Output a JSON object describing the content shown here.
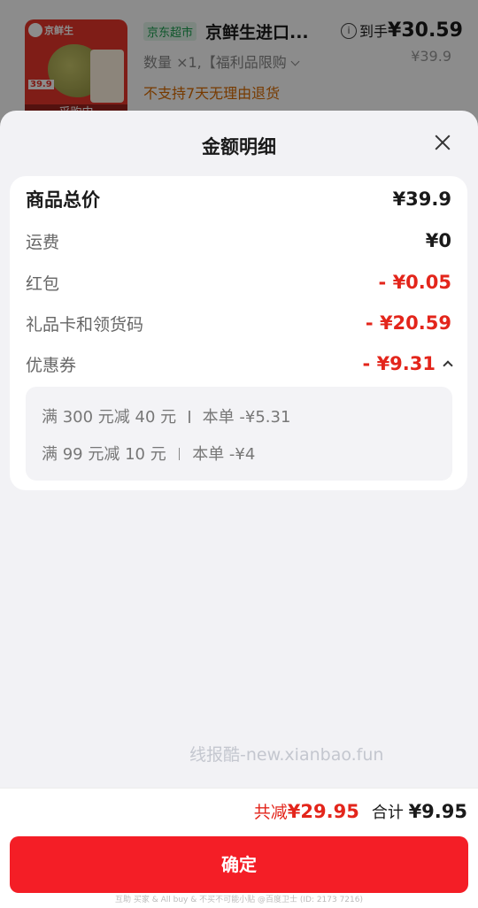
{
  "background_order": {
    "thumbnail": {
      "brand": "京鲜生",
      "price_tag": "39.9",
      "status": "采购中"
    },
    "store_tag": "京东超市",
    "product_name": "京鲜生进口...",
    "quantity_line": "数量 ×1,【福利品限购",
    "no_return_notice": "不支持7天无理由退货",
    "info_icon": "i",
    "arrive_label": "到手",
    "arrive_price": "¥30.59",
    "original_price": "¥39.9"
  },
  "sheet": {
    "title": "金额明细",
    "rows": [
      {
        "label": "商品总价",
        "value": "¥39.9"
      },
      {
        "label": "运费",
        "value": "¥0"
      },
      {
        "label": "红包",
        "value": "- ¥0.05"
      },
      {
        "label": "礼品卡和领货码",
        "value": "- ¥20.59"
      },
      {
        "label": "优惠券",
        "value": "- ¥9.31"
      }
    ],
    "coupons": [
      {
        "rule": "满 300 元减 40 元",
        "this_order": "本单 -¥5.31"
      },
      {
        "rule": "满 99 元减 10 元",
        "this_order": "本单 -¥4"
      }
    ]
  },
  "watermark": "线报酷-new.xianbao.fun",
  "footer": {
    "reduced_label": "共减",
    "reduced_value": "¥29.95",
    "total_label": "合计",
    "total_value": "¥9.95",
    "confirm_label": "确定",
    "footnote": "互助 买家 & All buy & 不买不可能小贴 @百度卫士 (ID: 2173 7216)"
  },
  "colors": {
    "accent_red": "#f41e26",
    "price_red": "#e3251b",
    "store_green": "#1a9e4f",
    "warning_orange": "#d96b00"
  },
  "icons": {
    "close": "close-icon",
    "info": "info-icon",
    "expand_up": "chevron-up-icon",
    "dropdown": "chevron-down-icon"
  }
}
